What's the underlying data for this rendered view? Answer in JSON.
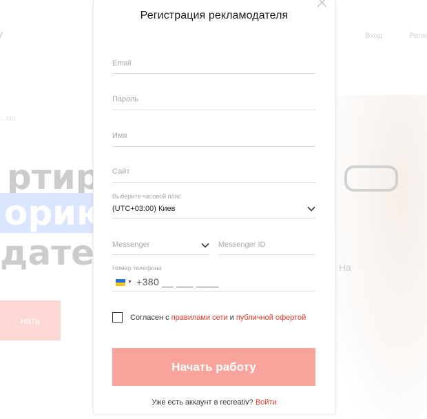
{
  "background": {
    "logo": "y",
    "breadcrumb": "...ме",
    "headline_line1": "ртиру",
    "headline_line2": "орию",
    "headline_line3": "дателе",
    "cta_label": "нать",
    "nav_item_1": "Вход",
    "nav_item_2": "Регист",
    "photo_caption": "На"
  },
  "modal": {
    "title": "Регистрация рекламодателя",
    "close_icon": "close-icon"
  },
  "form": {
    "email_placeholder": "Email",
    "password_placeholder": "Пароль",
    "name_placeholder": "Имя",
    "site_placeholder": "Сайт",
    "timezone": {
      "label": "Выберите часовой пояс",
      "value": "(UTC+03:00) Киев"
    },
    "messenger": {
      "type_placeholder": "Messenger",
      "id_placeholder": "Messenger ID"
    },
    "phone": {
      "label": "Номер телефона",
      "country_flag": "ukraine-flag",
      "value": "+380 __ ___ ____"
    },
    "agreement": {
      "prefix": "Согласен с ",
      "rules_link": "правилами сети",
      "conjunction": " и ",
      "offer_link": "публичной офертой",
      "checked": false
    },
    "submit_label": "Начать работу",
    "login_prompt": "Уже есть аккаунт в recreativ? ",
    "login_link": "Войти"
  },
  "colors": {
    "accent": "#e23a2c",
    "submit_bg": "#f8a49c",
    "border": "#dcdcdc",
    "placeholder": "#a8a8a8"
  }
}
